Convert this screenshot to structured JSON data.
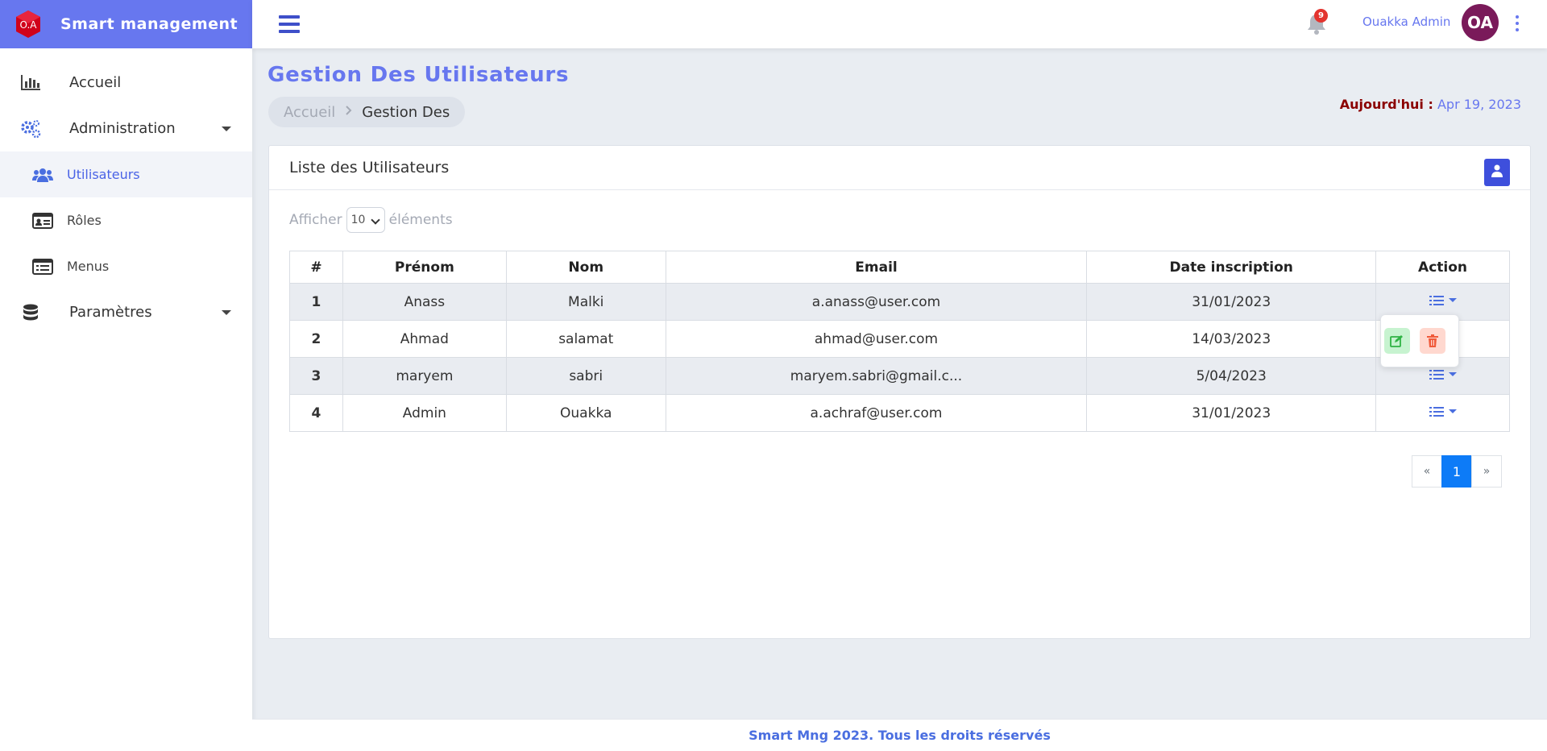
{
  "brand": {
    "logo_text": "O.A",
    "title": "Smart management"
  },
  "sidebar": {
    "items": [
      {
        "label": "Accueil",
        "icon": "bar-chart-icon"
      },
      {
        "label": "Administration",
        "icon": "cogs-icon",
        "expandable": true
      },
      {
        "label": "Utilisateurs",
        "icon": "users-icon",
        "active": true,
        "sub": true
      },
      {
        "label": "Rôles",
        "icon": "id-card-icon",
        "sub": true
      },
      {
        "label": "Menus",
        "icon": "list-alt-icon",
        "sub": true
      },
      {
        "label": "Paramètres",
        "icon": "database-icon",
        "expandable": true
      }
    ]
  },
  "topbar": {
    "notifications_count": "9",
    "user_name": "Ouakka Admin",
    "avatar_initials": "OA"
  },
  "page": {
    "title": "Gestion Des Utilisateurs",
    "breadcrumb": {
      "home": "Accueil",
      "current": "Gestion Des"
    },
    "today_label": "Aujourd'hui :",
    "today_value": "Apr 19, 2023"
  },
  "card": {
    "title": "Liste des Utilisateurs",
    "length": {
      "before": "Afficher",
      "value": "10",
      "after": "éléments"
    }
  },
  "table": {
    "headers": [
      "#",
      "Prénom",
      "Nom",
      "Email",
      "Date inscription",
      "Action"
    ],
    "rows": [
      {
        "num": "1",
        "prenom": "Anass",
        "nom": "Malki",
        "email": "a.anass@user.com",
        "date": "31/01/2023"
      },
      {
        "num": "2",
        "prenom": "Ahmad",
        "nom": "salamat",
        "email": "ahmad@user.com",
        "date": "14/03/2023"
      },
      {
        "num": "3",
        "prenom": "maryem",
        "nom": "sabri",
        "email": "maryem.sabri@gmail.c...",
        "date": "5/04/2023"
      },
      {
        "num": "4",
        "prenom": "Admin",
        "nom": "Ouakka",
        "email": "a.achraf@user.com",
        "date": "31/01/2023"
      }
    ]
  },
  "pagination": {
    "prev": "«",
    "current": "1",
    "next": "»"
  },
  "footer": {
    "text": "Smart Mng 2023. Tous les droits réservés"
  },
  "colors": {
    "accent": "#6777ef",
    "primary_button": "#3e4fdc",
    "page_active": "#0d7bf7",
    "date_label": "#8b0000"
  }
}
